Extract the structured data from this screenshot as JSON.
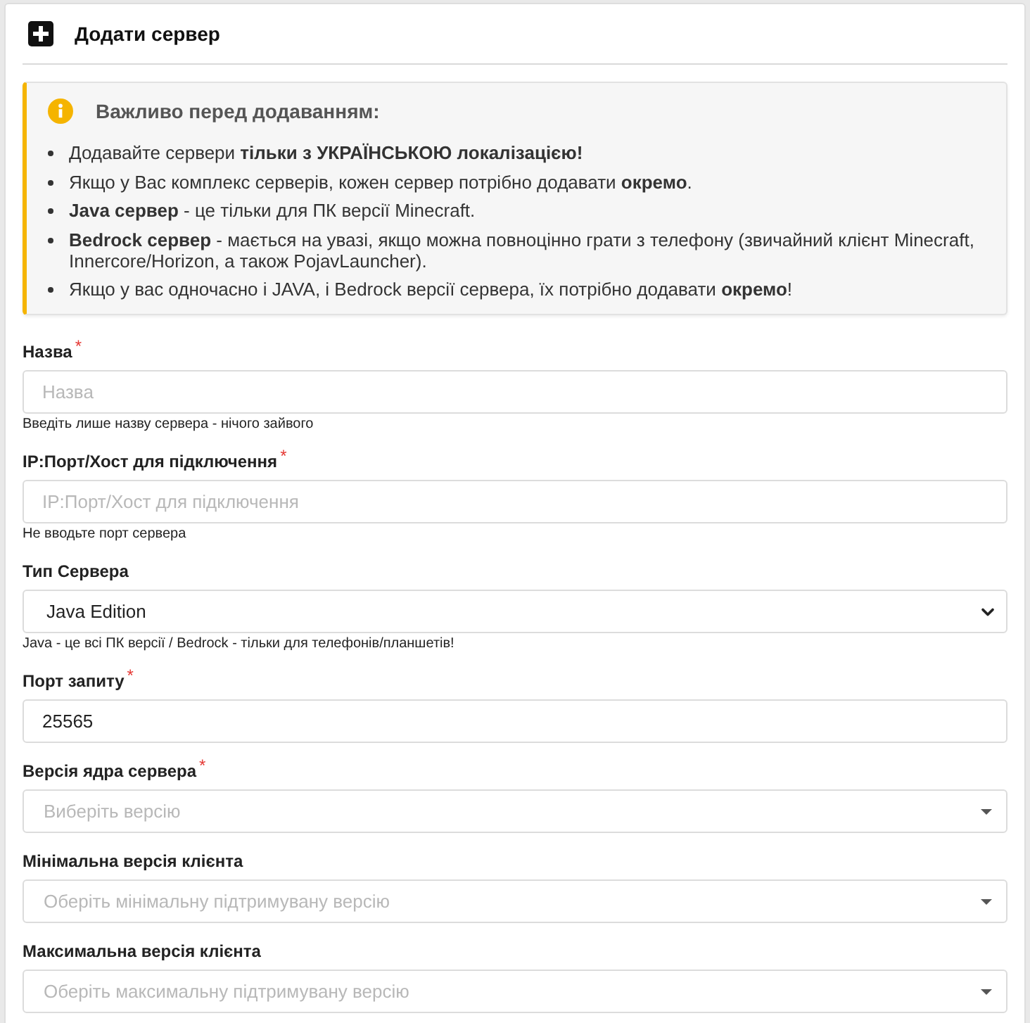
{
  "header": {
    "title": "Додати сервер"
  },
  "notice": {
    "title": "Важливо перед додаванням:",
    "items": [
      "Додавайте сервери **тільки з УКРАЇНСЬКОЮ локалізацією!**",
      "Якщо у Вас комплекс серверів, кожен сервер потрібно додавати **окремо**.",
      "**Java сервер** - це тільки для ПК версії Minecraft.",
      "**Bedrock сервер** - мається на увазі, якщо можна повноцінно грати з телефону (звичайний клієнт Minecraft, Innercore/Horizon, а також PojavLauncher).",
      "Якщо у вас одночасно і JAVA, і Bedrock версії сервера, їх потрібно додавати **окремо**!"
    ]
  },
  "fields": [
    {
      "kind": "text",
      "label": "Назва",
      "required_mark": "*",
      "placeholder": "Назва",
      "help": "Введіть лише назву сервера - нічого зайвого"
    },
    {
      "kind": "text",
      "label": "IP:Порт/Хост для підключення",
      "required_mark": "*",
      "placeholder": "IP:Порт/Хост для підключення",
      "help": "Не вводьте порт сервера"
    },
    {
      "kind": "select",
      "label": "Тип Сервера",
      "value": "Java Edition",
      "help": "Java - це всі ПК версії / Bedrock - тільки для телефонів/планшетів!"
    },
    {
      "kind": "text",
      "label": "Порт запиту",
      "required_mark": "*",
      "value": "25565"
    },
    {
      "kind": "dropdown",
      "label": "Версія ядра сервера",
      "required_mark": "*",
      "placeholder": "Виберіть версію"
    },
    {
      "kind": "dropdown",
      "label": "Мінімальна версія клієнта",
      "placeholder": "Оберіть мінімальну підтримувану версію"
    },
    {
      "kind": "dropdown",
      "label": "Максимальна версія клієнта",
      "placeholder": "Оберіть максимальну підтримувану версію"
    }
  ]
}
